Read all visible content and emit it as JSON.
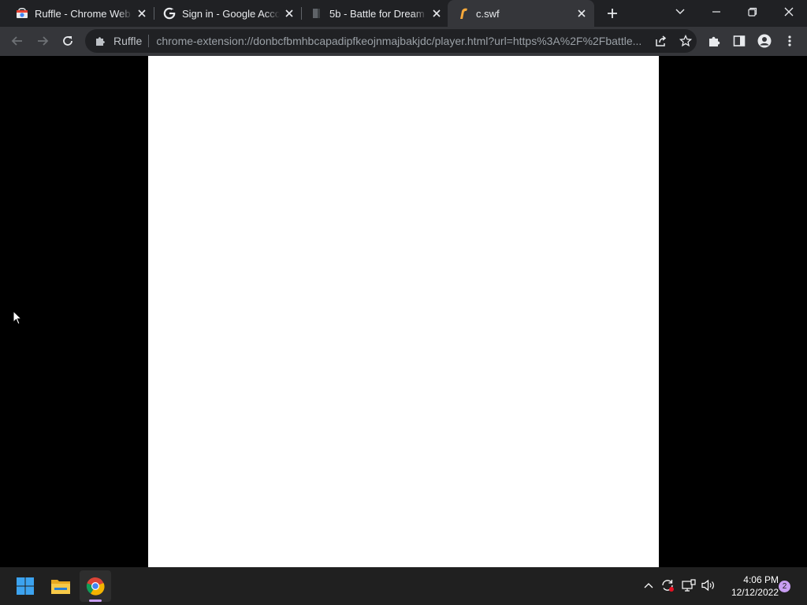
{
  "tabs": [
    {
      "title": "Ruffle - Chrome Web Store",
      "icon": "chrome-web-store-icon"
    },
    {
      "title": "Sign in - Google Accounts",
      "icon": "google-icon"
    },
    {
      "title": "5b - Battle for Dream Island",
      "icon": "page-icon"
    },
    {
      "title": "c.swf",
      "icon": "ruffle-icon",
      "active": true
    }
  ],
  "toolbar": {
    "site_chip": "Ruffle",
    "url": "chrome-extension://donbcfbmhbcapadipfkeojnmajbakjdc/player.html?url=https%3A%2F%2Fbattle..."
  },
  "taskbar": {
    "time": "4:06 PM",
    "date": "12/12/2022",
    "notification_count": "2"
  },
  "colors": {
    "titlebar": "#202124",
    "toolbar": "#35363a",
    "omnibox": "#202124",
    "player_background": "#ffffff",
    "page_background": "#000000",
    "taskbar": "#202020",
    "accent": "#c89ef2"
  }
}
